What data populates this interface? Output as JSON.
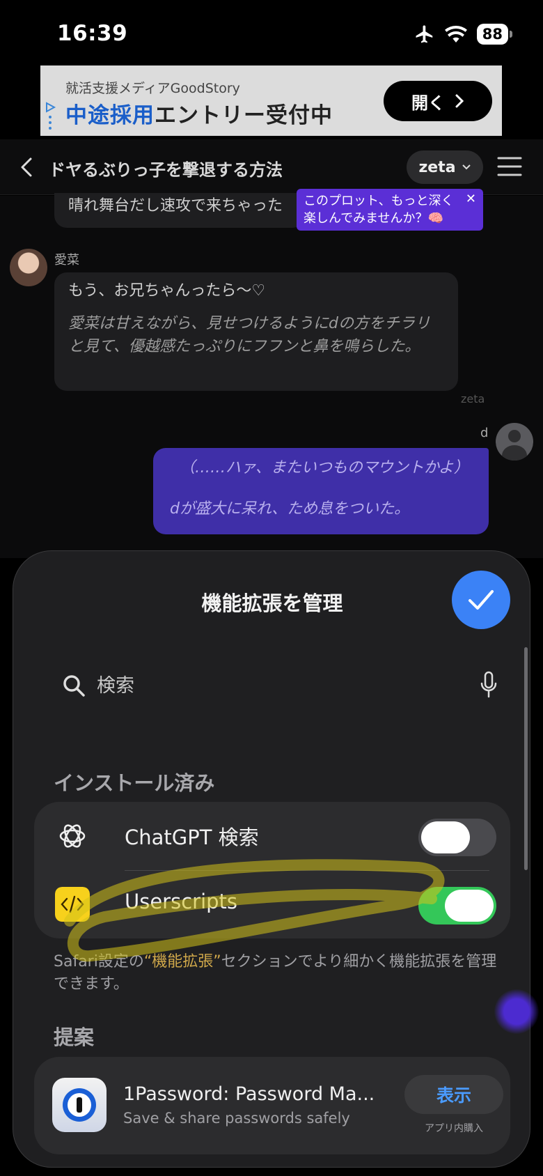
{
  "status_bar": {
    "time": "16:39",
    "battery": "88",
    "icons": [
      "airplane-icon",
      "wifi-icon",
      "battery-icon"
    ]
  },
  "ad": {
    "sub": "就活支援メディアGoodStory",
    "main_highlight": "中途採用",
    "main_rest": "エントリー受付中",
    "cta": "開く"
  },
  "header": {
    "title": "ドヤるぶりっ子を撃退する方法",
    "model": "zeta"
  },
  "chat": {
    "top_bubble": "晴れ舞台だし速攻で来ちゃった",
    "tooltip_line1": "このプロット、もっと深く",
    "tooltip_line2": "楽しんでみませんか？🧠",
    "tooltip_close": "✕",
    "ai_name": "愛菜",
    "ai_line": "もう、お兄ちゃんったら〜♡",
    "ai_action": "愛菜は甘えながら、見せつけるようにdの方をチラリと見て、優越感たっぷりにフフンと鼻を鳴らした。",
    "ai_tag": "zeta",
    "user_name": "d",
    "user_line1": "（……ハァ、またいつものマウントかよ）",
    "user_line2": "dが盛大に呆れ、ため息をついた。"
  },
  "sheet": {
    "title": "機能拡張を管理",
    "search_placeholder": "検索",
    "installed_label": "インストール済み",
    "extensions": [
      {
        "name": "ChatGPT 検索",
        "enabled": false,
        "icon": "openai-icon"
      },
      {
        "name": "Userscripts",
        "enabled": true,
        "icon": "code-icon"
      }
    ],
    "footnote_pre": "Safari設定の",
    "footnote_quote": "“機能拡張”",
    "footnote_post": "セクションでより細かく機能拡張を管理できます。",
    "suggest_label": "提案",
    "suggestion": {
      "name": "1Password: Password Ma...",
      "subtitle": "Save & share passwords safely",
      "button": "表示",
      "note": "アプリ内購入",
      "icon": "1password-icon"
    }
  },
  "colors": {
    "accent_blue": "#3b82f6",
    "toggle_on": "#34c759",
    "user_bubble": "#3f2fa8",
    "tooltip": "#5b2fd6",
    "highlight": "#d4c21a"
  }
}
